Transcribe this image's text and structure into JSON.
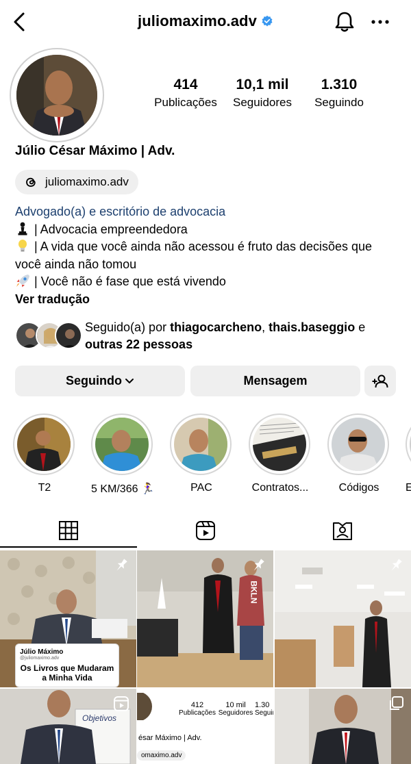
{
  "header": {
    "username": "juliomaximo.adv",
    "verified": true
  },
  "profile": {
    "stats": [
      {
        "value": "414",
        "label": "Publicações"
      },
      {
        "value": "10,1 mil",
        "label": "Seguidores"
      },
      {
        "value": "1.310",
        "label": "Seguindo"
      }
    ],
    "full_name": "Júlio César Máximo | Adv.",
    "threads_handle": "juliomaximo.adv",
    "category": "Advogado(a) e escritório de advocacia",
    "bio_lines": [
      {
        "icon": "chess-pawn-icon",
        "text": "| Advocacia empreendedora"
      },
      {
        "icon": "lightbulb-icon",
        "text": "| A vida que você ainda não acessou é fruto das decisões que você ainda não tomou"
      },
      {
        "icon": "rocket-icon",
        "text": "| Você não é fase que está vivendo"
      }
    ],
    "see_translation": "Ver tradução",
    "followed_by": {
      "prefix": "Seguido(a) por",
      "user1": "thiagocarcheno",
      "sep": ",",
      "user2": "thais.baseggio",
      "conj": "e",
      "others": "outras 22 pessoas"
    }
  },
  "actions": {
    "following_label": "Seguindo",
    "message_label": "Mensagem"
  },
  "highlights": [
    {
      "label": "T2"
    },
    {
      "label": "5 KM/366 🏃‍♀️"
    },
    {
      "label": "PAC"
    },
    {
      "label": "Contratos..."
    },
    {
      "label": "Códigos"
    },
    {
      "label": "E"
    }
  ],
  "grid_posts": {
    "post1_card_name": "Júlio Máximo",
    "post1_card_handle": "@juliomaximo.adv",
    "post1_card_title": "Os Livros que Mudaram a Minha Vida",
    "post2_sign": "BKLN",
    "post5_mini": {
      "stats": [
        {
          "value": "412",
          "label": "Publicações"
        },
        {
          "value": "10 mil",
          "label": "Seguidores"
        },
        {
          "value": "1.30",
          "label": "Seguind"
        }
      ],
      "name": "ésar Máximo | Adv.",
      "handle": "omaximo.adv"
    },
    "post4_whiteboard": "Objetivos"
  },
  "colors": {
    "verified": "#3897f0",
    "category_link": "#1c3f6e",
    "button_bg": "#efefef"
  }
}
